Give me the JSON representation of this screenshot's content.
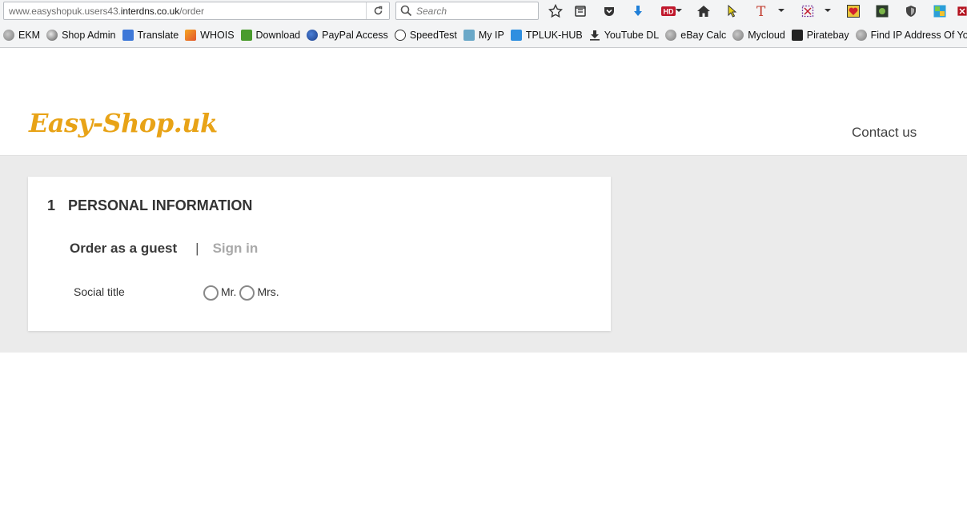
{
  "browser": {
    "url_prefix": "www.easyshopuk.users43.",
    "url_domain": "interdns.co.uk",
    "url_path": "/order",
    "search_placeholder": "Search"
  },
  "bookmarks": [
    {
      "label": "EKM",
      "icon": "globe-icon"
    },
    {
      "label": "Shop Admin",
      "icon": "shop-icon"
    },
    {
      "label": "Translate",
      "icon": "translate-icon"
    },
    {
      "label": "WHOIS",
      "icon": "whois-icon"
    },
    {
      "label": "Download",
      "icon": "download-icon"
    },
    {
      "label": "PayPal Access",
      "icon": "paypal-icon"
    },
    {
      "label": "SpeedTest",
      "icon": "speedometer-icon"
    },
    {
      "label": "My IP",
      "icon": "ip-icon"
    },
    {
      "label": "TPLUK-HUB",
      "icon": "tp-icon"
    },
    {
      "label": "YouTube DL",
      "icon": "download-arrow-icon"
    },
    {
      "label": "eBay Calc",
      "icon": "globe-icon"
    },
    {
      "label": "Mycloud",
      "icon": "globe-icon"
    },
    {
      "label": "Piratebay",
      "icon": "pirate-icon"
    },
    {
      "label": "Find IP Address Of Yo...",
      "icon": "globe-icon"
    }
  ],
  "site": {
    "logo_text": "Easy-Shop.uk",
    "contact_label": "Contact us",
    "brand_color": "#e8a317"
  },
  "checkout": {
    "step_number": "1",
    "step_title": "PERSONAL INFORMATION",
    "tab_guest": "Order as a guest",
    "tab_separator": "|",
    "tab_signin": "Sign in",
    "social_title_label": "Social title",
    "options": [
      "Mr.",
      "Mrs."
    ]
  }
}
